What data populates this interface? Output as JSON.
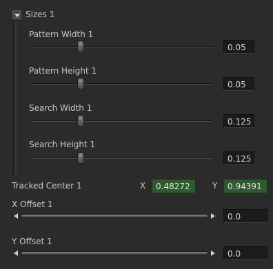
{
  "group": {
    "title": "Sizes 1",
    "expanded": true
  },
  "sliders": [
    {
      "label": "Pattern Width 1",
      "value": "0.05"
    },
    {
      "label": "Pattern Height 1",
      "value": "0.05"
    },
    {
      "label": "Search Width 1",
      "value": "0.125"
    },
    {
      "label": "Search Height 1",
      "value": "0.125"
    }
  ],
  "tracked_center": {
    "label": "Tracked Center 1",
    "x_label": "X",
    "x_value": "0.48272",
    "y_label": "Y",
    "y_value": "0.94391"
  },
  "offsets": [
    {
      "label": "X Offset 1",
      "value": "0.0"
    },
    {
      "label": "Y Offset 1",
      "value": "0.0"
    }
  ],
  "colors": {
    "background": "#2b2b2b",
    "input_bg": "#1b1b1b",
    "tracked_value_bg": "#2f5a2f"
  }
}
